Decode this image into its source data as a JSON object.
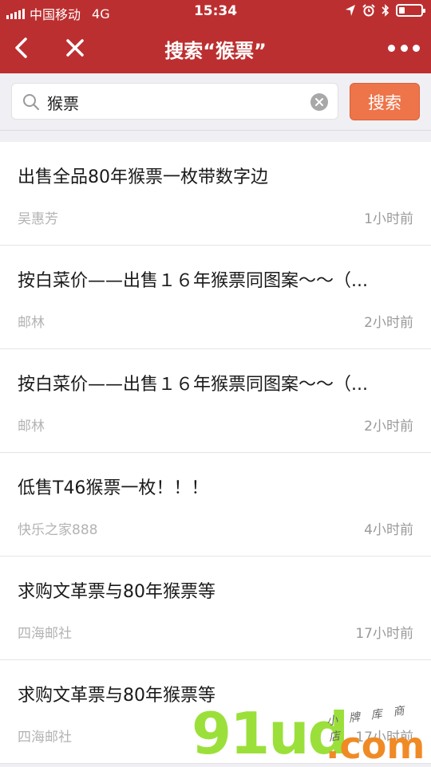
{
  "status_bar": {
    "carrier": "中国移动",
    "network": "4G",
    "time": "15:34",
    "battery_level": 0.25
  },
  "nav": {
    "title": "搜索“猴票”"
  },
  "search": {
    "query": "猴票",
    "button_label": "搜索"
  },
  "results": [
    {
      "title": "出售全品80年猴票一枚带数字边",
      "author": "吴惠芳",
      "time": "1小时前"
    },
    {
      "title": "按白菜价——出售１６年猴票同图案～～（...",
      "author": "邮林",
      "time": "2小时前"
    },
    {
      "title": "按白菜价——出售１６年猴票同图案～～（...",
      "author": "邮林",
      "time": "2小时前"
    },
    {
      "title": "低售T46猴票一枚！！！",
      "author": "快乐之家888",
      "time": "4小时前"
    },
    {
      "title": "求购文革票与80年猴票等",
      "author": "四海邮社",
      "time": "17小时前"
    },
    {
      "title": "求购文革票与80年猴票等",
      "author": "四海邮社",
      "time": "17小时前"
    }
  ],
  "watermark": {
    "main": "91ud",
    "suffix": ".com",
    "tagline": "小　牌　库　商　店"
  },
  "colors": {
    "header": "#bc2f30",
    "search_button": "#ee7449"
  }
}
